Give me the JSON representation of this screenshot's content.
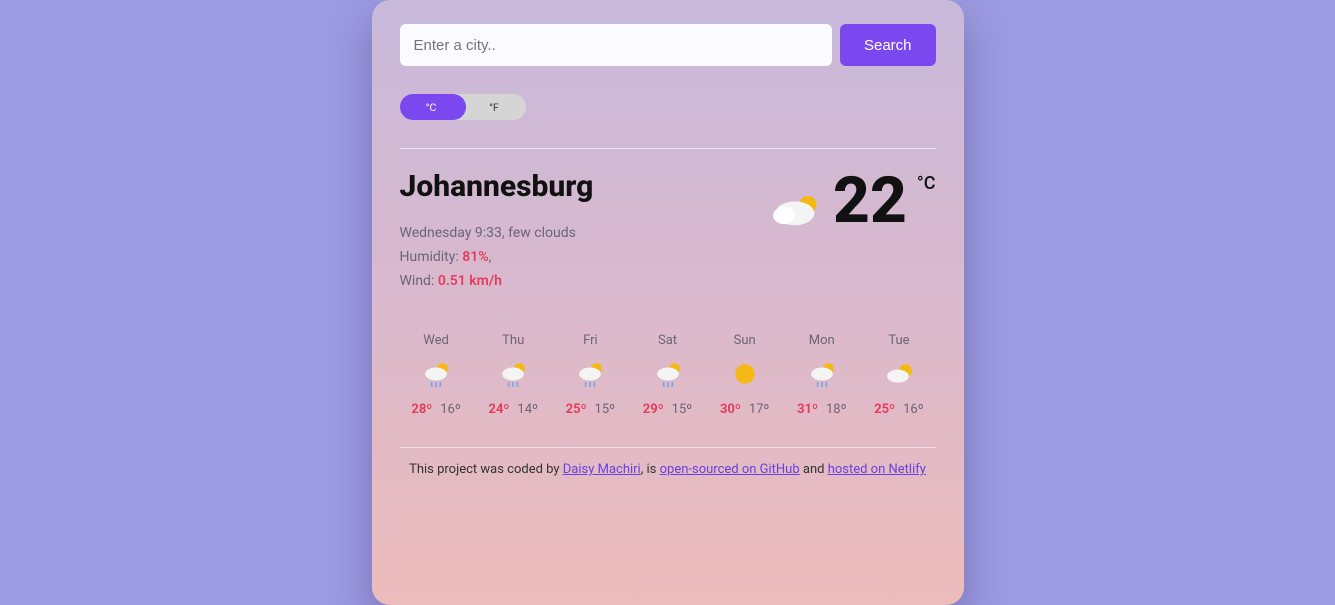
{
  "search": {
    "placeholder": "Enter a city..",
    "button": "Search"
  },
  "units": {
    "c": "°C",
    "f": "°F",
    "active": "c"
  },
  "city": "Johannesburg",
  "dateline": "Wednesday 9:33, few clouds",
  "humidity_label": "Humidity: ",
  "humidity_value": "81%",
  "wind_label": "Wind: ",
  "wind_value": "0.51 km/h",
  "temp": "22",
  "temp_unit": "°C",
  "icons": {
    "current": "cloud-sun",
    "rain-sun": "rain-sun",
    "sun": "sun",
    "partly": "partly"
  },
  "forecast": [
    {
      "day": "Wed",
      "icon": "rain-sun",
      "hi": "28º",
      "lo": "16º"
    },
    {
      "day": "Thu",
      "icon": "rain-sun",
      "hi": "24º",
      "lo": "14º"
    },
    {
      "day": "Fri",
      "icon": "rain-sun",
      "hi": "25º",
      "lo": "15º"
    },
    {
      "day": "Sat",
      "icon": "rain-sun",
      "hi": "29º",
      "lo": "15º"
    },
    {
      "day": "Sun",
      "icon": "sun",
      "hi": "30º",
      "lo": "17º"
    },
    {
      "day": "Mon",
      "icon": "rain-sun",
      "hi": "31º",
      "lo": "18º"
    },
    {
      "day": "Tue",
      "icon": "partly",
      "hi": "25º",
      "lo": "16º"
    }
  ],
  "footer": {
    "prefix": "This project was coded by ",
    "author": "Daisy Machiri",
    "mid1": ", is ",
    "link2": "open-sourced on GitHub",
    "mid2": " and ",
    "link3": "hosted on Netlify"
  }
}
